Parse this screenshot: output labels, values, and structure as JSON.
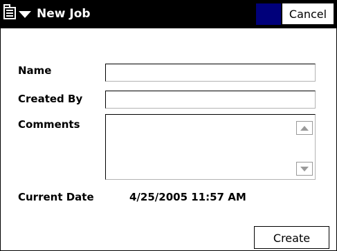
{
  "window": {
    "title": "New Job",
    "cancel_label": "Cancel",
    "menu_icon": "app-menu-icon",
    "accent_color": "#00007a"
  },
  "form": {
    "name_label": "Name",
    "name_value": "",
    "created_by_label": "Created By",
    "created_by_value": "",
    "comments_label": "Comments",
    "comments_value": "",
    "current_date_label": "Current Date",
    "current_date_value": "4/25/2005 11:57 AM"
  },
  "actions": {
    "create_label": "Create"
  }
}
